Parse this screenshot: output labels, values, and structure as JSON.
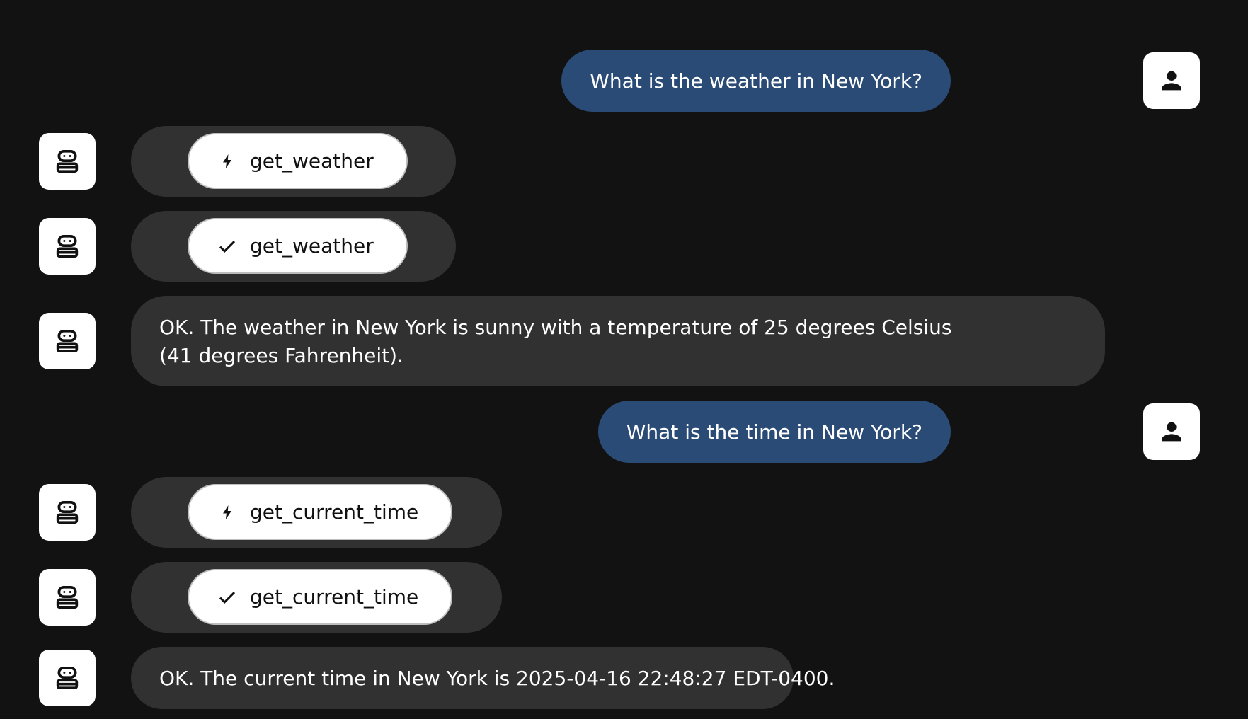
{
  "messages": [
    {
      "role": "user",
      "kind": "text",
      "text": "What is the weather in New York?"
    },
    {
      "role": "assistant",
      "kind": "tool_call",
      "status_icon": "bolt-icon",
      "tool_name": "get_weather"
    },
    {
      "role": "assistant",
      "kind": "tool_result",
      "status_icon": "check-icon",
      "tool_name": "get_weather"
    },
    {
      "role": "assistant",
      "kind": "text",
      "text": "OK. The weather in New York is sunny with a temperature of 25 degrees Celsius (41 degrees Fahrenheit)."
    },
    {
      "role": "user",
      "kind": "text",
      "text": "What is the time in New York?"
    },
    {
      "role": "assistant",
      "kind": "tool_call",
      "status_icon": "bolt-icon",
      "tool_name": "get_current_time"
    },
    {
      "role": "assistant",
      "kind": "tool_result",
      "status_icon": "check-icon",
      "tool_name": "get_current_time"
    },
    {
      "role": "assistant",
      "kind": "text",
      "text": "OK. The current time in New York is 2025-04-16 22:48:27 EDT-0400."
    }
  ],
  "icons": {
    "user_avatar": "person-icon",
    "assistant_avatar": "robot-icon"
  },
  "colors": {
    "background": "#121212",
    "user_bubble": "#2b4b77",
    "assistant_bubble": "#313131",
    "tool_pill": "#ffffff",
    "avatar_bg": "#ffffff"
  }
}
